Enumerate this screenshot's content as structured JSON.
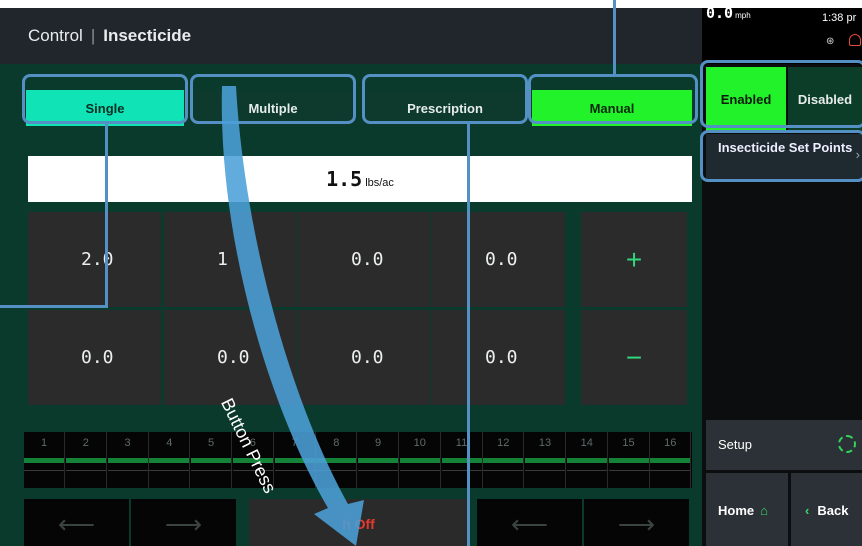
{
  "header": {
    "section": "Control",
    "title": "Insecticide"
  },
  "status": {
    "speed": "0.0",
    "speed_unit": "mph",
    "time": "1:38 pr"
  },
  "modes": [
    {
      "label": "Single",
      "state": "selected"
    },
    {
      "label": "Multiple",
      "state": "normal"
    },
    {
      "label": "Prescription",
      "state": "normal"
    },
    {
      "label": "Manual",
      "state": "active"
    }
  ],
  "control": {
    "enabled_label": "Enabled",
    "disabled_label": "Disabled",
    "selected": "Enabled"
  },
  "set_points": {
    "label": "Insecticide Set Points"
  },
  "rate": {
    "value": "1.5",
    "unit": "lbs/ac"
  },
  "presets": {
    "row1": [
      "2.0",
      "1",
      "0.0",
      "0.0"
    ],
    "row2": [
      "0.0",
      "0.0",
      "0.0",
      "0.0"
    ]
  },
  "adjust": {
    "plus": "+",
    "minus": "−"
  },
  "sections": [
    "1",
    "2",
    "3",
    "4",
    "5",
    "6",
    "7",
    "8",
    "9",
    "10",
    "11",
    "12",
    "13",
    "14",
    "15",
    "16"
  ],
  "bottom": {
    "switch_label": "h Off"
  },
  "nav": {
    "setup": "Setup",
    "home": "Home",
    "back": "Back"
  },
  "annotation": {
    "label": "Button Press"
  },
  "colors": {
    "accent_green": "#22f22a",
    "selected_teal": "#10e3b5",
    "panel_green": "#0a3a2c",
    "highlight_blue": "#5590c5"
  }
}
